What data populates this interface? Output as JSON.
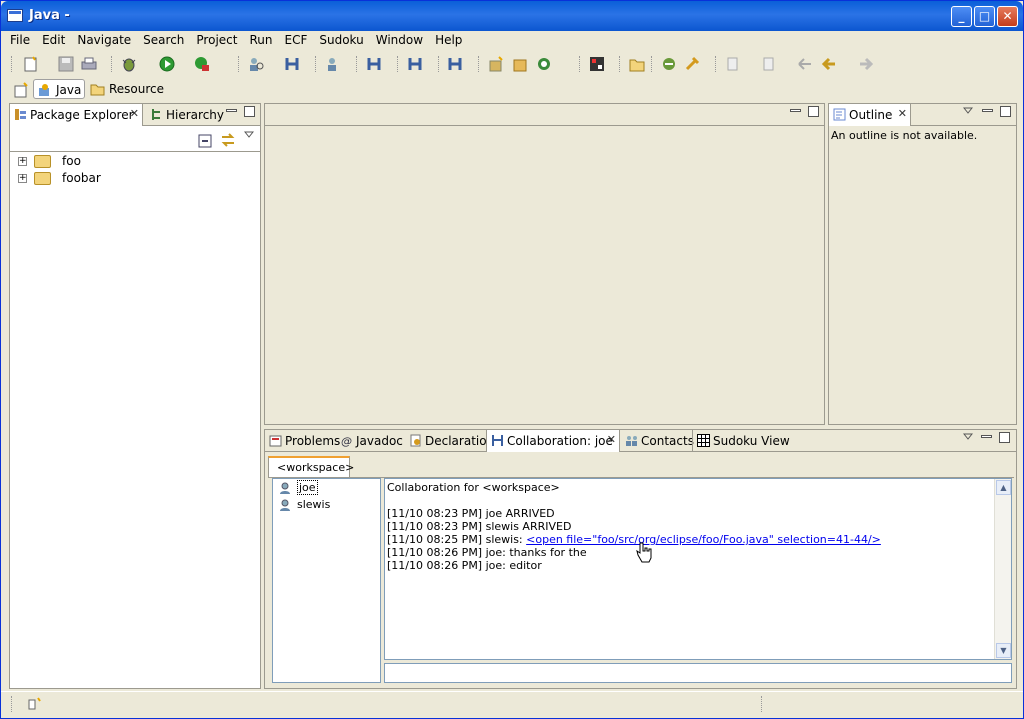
{
  "window": {
    "title": "Java -",
    "minimize": "_",
    "maximize": "□",
    "close": "✕"
  },
  "menu": [
    "File",
    "Edit",
    "Navigate",
    "Search",
    "Project",
    "Run",
    "ECF",
    "Sudoku",
    "Window",
    "Help"
  ],
  "perspectives": {
    "java": "Java",
    "resource": "Resource"
  },
  "package_explorer": {
    "tab_label": "Package Explorer",
    "hierarchy_tab": "Hierarchy",
    "items": [
      {
        "label": "foo",
        "expander": "+"
      },
      {
        "label": "foobar",
        "expander": "+"
      }
    ]
  },
  "outline": {
    "tab_label": "Outline",
    "message": "An outline is not available."
  },
  "bottom_tabs": [
    "Problems",
    "Javadoc",
    "Declaration",
    "Collaboration: joe",
    "Contacts",
    "Sudoku View"
  ],
  "collab": {
    "subtab": "<workspace>",
    "users": [
      "joe",
      "slewis"
    ],
    "log": [
      "Collaboration for <workspace>",
      "",
      "[11/10 08:23 PM] joe ARRIVED",
      "[11/10 08:23 PM] slewis ARRIVED"
    ],
    "link_prefix": "[11/10 08:25 PM] slewis: ",
    "link_text": "<open file=\"foo/src/org/eclipse/foo/Foo.java\" selection=41-44/>",
    "after": [
      "[11/10 08:26 PM] joe: thanks for the",
      "[11/10 08:26 PM] joe: editor"
    ]
  },
  "colors": {
    "title_bar": "#0a5fd8",
    "accent": "#ece9d8",
    "link": "#0000ee"
  }
}
